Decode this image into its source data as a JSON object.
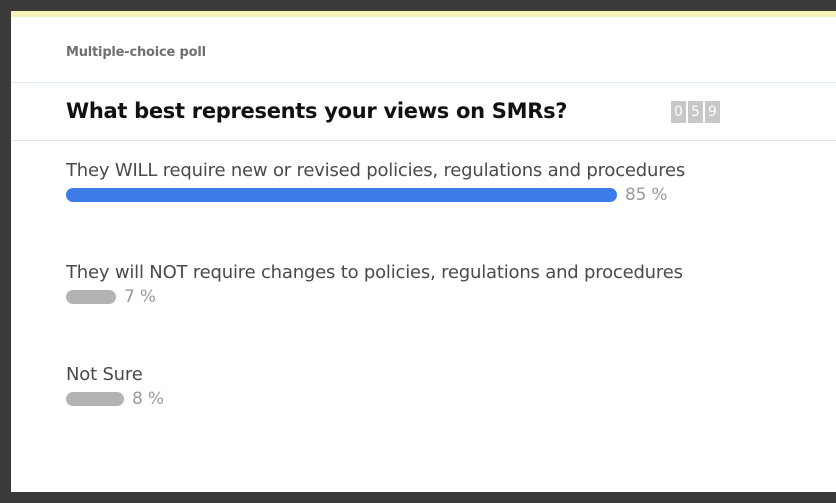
{
  "poll": {
    "type_label": "Multiple-choice poll",
    "question": "What best represents your views on SMRs?",
    "counter_digits": [
      "0",
      "5",
      "9"
    ],
    "accent_color": "#3d7be8",
    "options": [
      {
        "label": "They WILL require new or revised policies, regulations and procedures",
        "percent": 85,
        "percent_label": "85 %",
        "leading": true
      },
      {
        "label": "They will NOT require changes to policies, regulations and procedures",
        "percent": 7,
        "percent_label": "7 %",
        "leading": false
      },
      {
        "label": "Not Sure",
        "percent": 8,
        "percent_label": "8 %",
        "leading": false
      }
    ]
  }
}
